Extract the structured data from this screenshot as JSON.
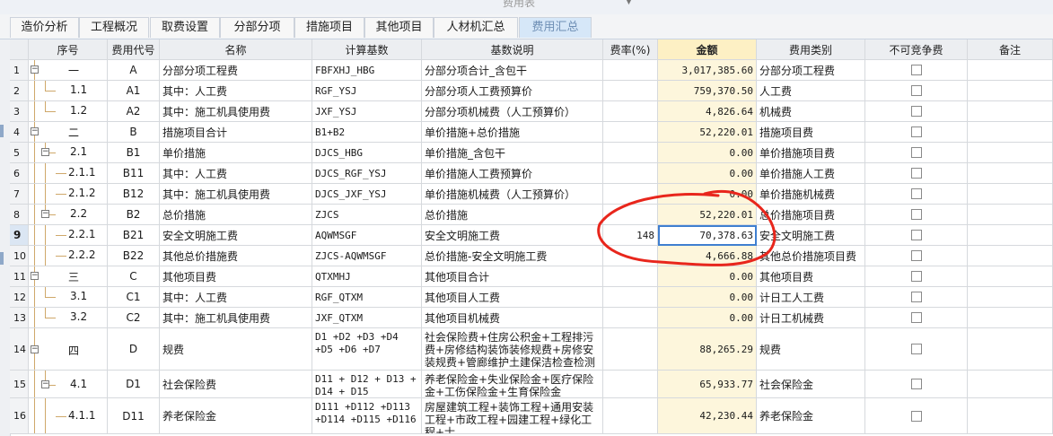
{
  "window": {
    "title": "费用表"
  },
  "tabs": [
    {
      "label": "造价分析"
    },
    {
      "label": "工程概况"
    },
    {
      "label": "取费设置"
    },
    {
      "label": "分部分项"
    },
    {
      "label": "措施项目"
    },
    {
      "label": "其他项目"
    },
    {
      "label": "人材机汇总"
    },
    {
      "label": "费用汇总",
      "active": true
    }
  ],
  "columns": [
    "序号",
    "费用代号",
    "名称",
    "计算基数",
    "基数说明",
    "费率(%)",
    "金额",
    "费用类别",
    "不可竞争费",
    "备注"
  ],
  "rows": [
    {
      "num": "1",
      "seq": "一",
      "code": "A",
      "name": "分部分项工程费",
      "base": "FBFXHJ_HBG",
      "desc": "分部分项合计_含包干",
      "rate": "",
      "amount": "3,017,385.60",
      "type": "分部分项工程费"
    },
    {
      "num": "2",
      "seq": "1.1",
      "code": "A1",
      "name": "其中：人工费",
      "base": "RGF_YSJ",
      "desc": "分部分项人工费预算价",
      "rate": "",
      "amount": "759,370.50",
      "type": "人工费"
    },
    {
      "num": "3",
      "seq": "1.2",
      "code": "A2",
      "name": "其中：施工机具使用费",
      "base": "JXF_YSJ",
      "desc": "分部分项机械费（人工预算价）",
      "rate": "",
      "amount": "4,826.64",
      "type": "机械费"
    },
    {
      "num": "4",
      "seq": "二",
      "code": "B",
      "name": "措施项目合计",
      "base": "B1+B2",
      "desc": "单价措施+总价措施",
      "rate": "",
      "amount": "52,220.01",
      "type": "措施项目费"
    },
    {
      "num": "5",
      "seq": "2.1",
      "code": "B1",
      "name": "单价措施",
      "base": "DJCS_HBG",
      "desc": "单价措施_含包干",
      "rate": "",
      "amount": "0.00",
      "type": "单价措施项目费"
    },
    {
      "num": "6",
      "seq": "2.1.1",
      "code": "B11",
      "name": "其中：人工费",
      "base": "DJCS_RGF_YSJ",
      "desc": "单价措施人工费预算价",
      "rate": "",
      "amount": "0.00",
      "type": "单价措施人工费"
    },
    {
      "num": "7",
      "seq": "2.1.2",
      "code": "B12",
      "name": "其中：施工机具使用费",
      "base": "DJCS_JXF_YSJ",
      "desc": "单价措施机械费（人工预算价）",
      "rate": "",
      "amount": "0.00",
      "type": "单价措施机械费"
    },
    {
      "num": "8",
      "seq": "2.2",
      "code": "B2",
      "name": "总价措施",
      "base": "ZJCS",
      "desc": "总价措施",
      "rate": "",
      "amount": "52,220.01",
      "type": "总价措施项目费"
    },
    {
      "num": "9",
      "seq": "2.2.1",
      "code": "B21",
      "name": "安全文明施工费",
      "base": "AQWMSGF",
      "desc": "安全文明施工费",
      "rate": "148",
      "amount": "70,378.63",
      "type": "安全文明施工费"
    },
    {
      "num": "10",
      "seq": "2.2.2",
      "code": "B22",
      "name": "其他总价措施费",
      "base": "ZJCS-AQWMSGF",
      "desc": "总价措施-安全文明施工费",
      "rate": "",
      "amount": "4,666.88",
      "type": "其他总价措施项目费"
    },
    {
      "num": "11",
      "seq": "三",
      "code": "C",
      "name": "其他项目费",
      "base": "QTXMHJ",
      "desc": "其他项目合计",
      "rate": "",
      "amount": "0.00",
      "type": "其他项目费"
    },
    {
      "num": "12",
      "seq": "3.1",
      "code": "C1",
      "name": "其中：人工费",
      "base": "RGF_QTXM",
      "desc": "其他项目人工费",
      "rate": "",
      "amount": "0.00",
      "type": "计日工人工费"
    },
    {
      "num": "13",
      "seq": "3.2",
      "code": "C2",
      "name": "其中：施工机具使用费",
      "base": "JXF_QTXM",
      "desc": "其他项目机械费",
      "rate": "",
      "amount": "0.00",
      "type": "计日工机械费"
    },
    {
      "num": "14",
      "seq": "四",
      "code": "D",
      "name": "规费",
      "base": "D1 +D2 +D3 +D4 +D5 +D6 +D7",
      "desc": "社会保险费+住房公积金+工程排污费+房修结构装饰装修规费+房修安装规费+管廊维护土建保洁检查检测规费+管廊维护附属规费",
      "rate": "",
      "amount": "88,265.29",
      "type": "规费"
    },
    {
      "num": "15",
      "seq": "4.1",
      "code": "D1",
      "name": "社会保险费",
      "base": "D11 + D12 + D13 + D14 + D15",
      "desc": "养老保险金+失业保险金+医疗保险金+工伤保险金+生育保险金",
      "rate": "",
      "amount": "65,933.77",
      "type": "社会保险金"
    },
    {
      "num": "16",
      "seq": "4.1.1",
      "code": "D11",
      "name": "养老保险金",
      "base": "D111 +D112 +D113 +D114 +D115 +D116",
      "desc": "房屋建筑工程+装饰工程+通用安装工程+市政工程+园建工程+绿化工程+士",
      "rate": "",
      "amount": "42,230.44",
      "type": "养老保险金"
    }
  ]
}
